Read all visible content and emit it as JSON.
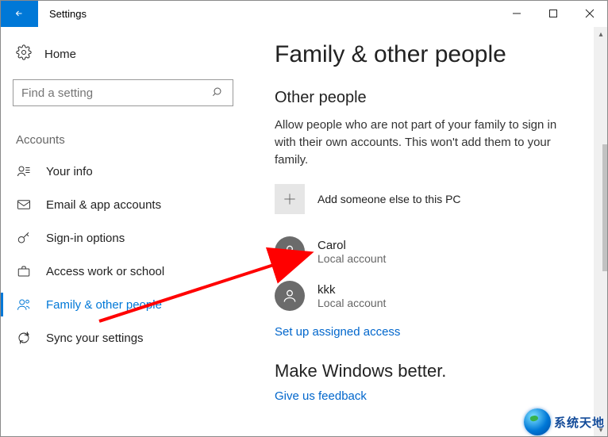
{
  "window": {
    "title": "Settings"
  },
  "sidebar": {
    "home": "Home",
    "search_placeholder": "Find a setting",
    "section": "Accounts",
    "items": [
      {
        "label": "Your info"
      },
      {
        "label": "Email & app accounts"
      },
      {
        "label": "Sign-in options"
      },
      {
        "label": "Access work or school"
      },
      {
        "label": "Family & other people"
      },
      {
        "label": "Sync your settings"
      }
    ],
    "active_index": 4
  },
  "content": {
    "heading": "Family & other people",
    "section1": {
      "title": "Other people",
      "desc": "Allow people who are not part of your family to sign in with their own accounts. This won't add them to your family.",
      "add_label": "Add someone else to this PC",
      "users": [
        {
          "name": "Carol",
          "type": "Local account"
        },
        {
          "name": "kkk",
          "type": "Local account"
        }
      ],
      "assigned_link": "Set up assigned access"
    },
    "section2": {
      "title": "Make Windows better.",
      "feedback_link": "Give us feedback"
    }
  },
  "watermark": "系统天地"
}
